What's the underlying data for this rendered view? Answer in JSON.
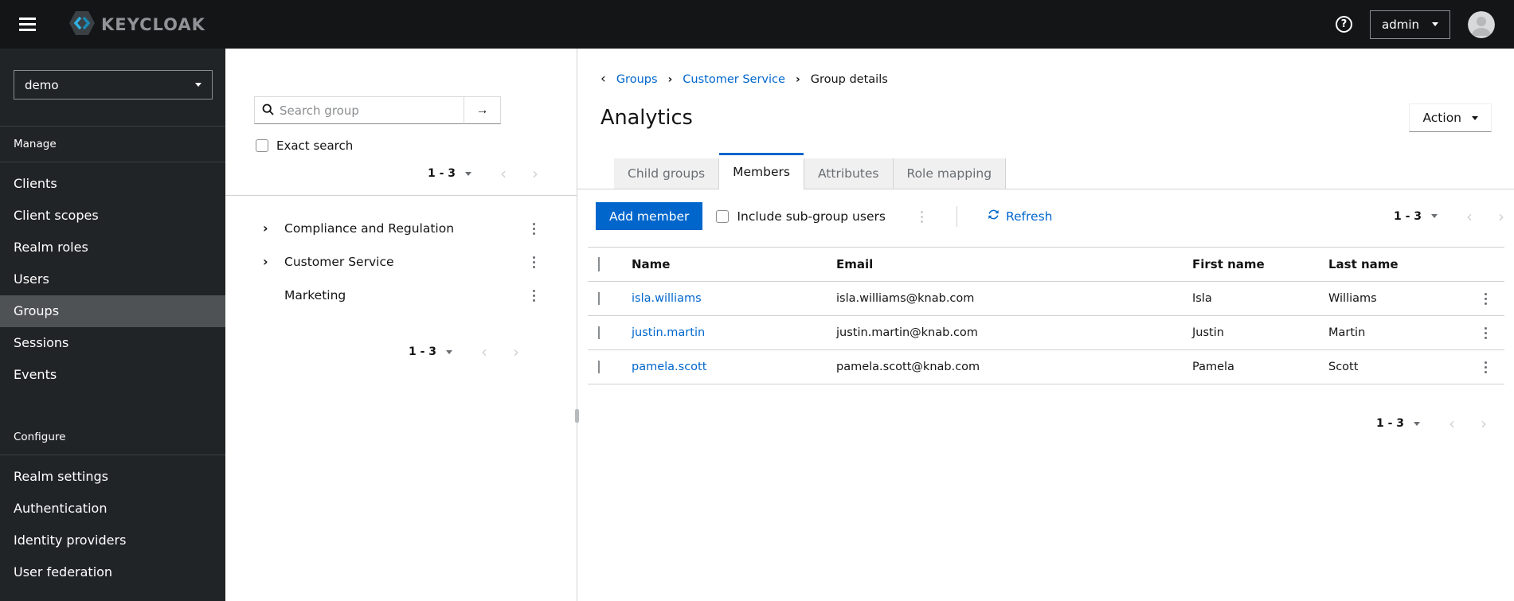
{
  "header": {
    "brand": "KEYCLOAK",
    "user_menu_label": "admin"
  },
  "sidebar": {
    "realm_selector": {
      "value": "demo"
    },
    "sections": [
      {
        "label": "Manage",
        "items": [
          "Clients",
          "Client scopes",
          "Realm roles",
          "Users",
          "Groups",
          "Sessions",
          "Events"
        ],
        "active_item": "Groups"
      },
      {
        "label": "Configure",
        "items": [
          "Realm settings",
          "Authentication",
          "Identity providers",
          "User federation"
        ]
      }
    ]
  },
  "tree_panel": {
    "search": {
      "placeholder": "Search group",
      "value": ""
    },
    "exact_search_label": "Exact search",
    "pagination_top": {
      "range": "1 - 3"
    },
    "groups": [
      {
        "name": "Compliance and Regulation",
        "expandable": true
      },
      {
        "name": "Customer Service",
        "expandable": true
      },
      {
        "name": "Marketing",
        "expandable": false
      }
    ],
    "pagination_bottom": {
      "range": "1 - 3"
    }
  },
  "main": {
    "breadcrumb": {
      "items": [
        "Groups",
        "Customer Service",
        "Group details"
      ]
    },
    "title": "Analytics",
    "action_label": "Action",
    "tabs": [
      {
        "label": "Child groups",
        "active": false
      },
      {
        "label": "Members",
        "active": true
      },
      {
        "label": "Attributes",
        "active": false
      },
      {
        "label": "Role mapping",
        "active": false
      }
    ],
    "toolbar": {
      "add_member_label": "Add member",
      "include_subgroup_label": "Include sub-group users",
      "refresh_label": "Refresh",
      "pagination": {
        "range": "1 - 3"
      }
    },
    "table": {
      "columns": [
        "Name",
        "Email",
        "First name",
        "Last name"
      ],
      "rows": [
        {
          "name": "isla.williams",
          "email": "isla.williams@knab.com",
          "first": "Isla",
          "last": "Williams"
        },
        {
          "name": "justin.martin",
          "email": "justin.martin@knab.com",
          "first": "Justin",
          "last": "Martin"
        },
        {
          "name": "pamela.scott",
          "email": "pamela.scott@knab.com",
          "first": "Pamela",
          "last": "Scott"
        }
      ]
    },
    "pagination_bottom": {
      "range": "1 - 3"
    }
  },
  "icons": {
    "help_glyph": "?",
    "prev_glyph": "‹",
    "next_glyph": "›",
    "expand_glyph": "›",
    "breadcrumb_sep_glyph": "›",
    "back_glyph": "‹",
    "search_submit_glyph": "→"
  },
  "colors": {
    "accent": "#0066cc",
    "link": "#0066cc",
    "brand_cyan": "#31b0e0",
    "masthead_bg": "#131517",
    "sidebar_bg": "#212427",
    "sidebar_active_bg": "#4f5255",
    "tab_inactive_bg": "#f0f0f0",
    "border": "#d2d2d2"
  }
}
